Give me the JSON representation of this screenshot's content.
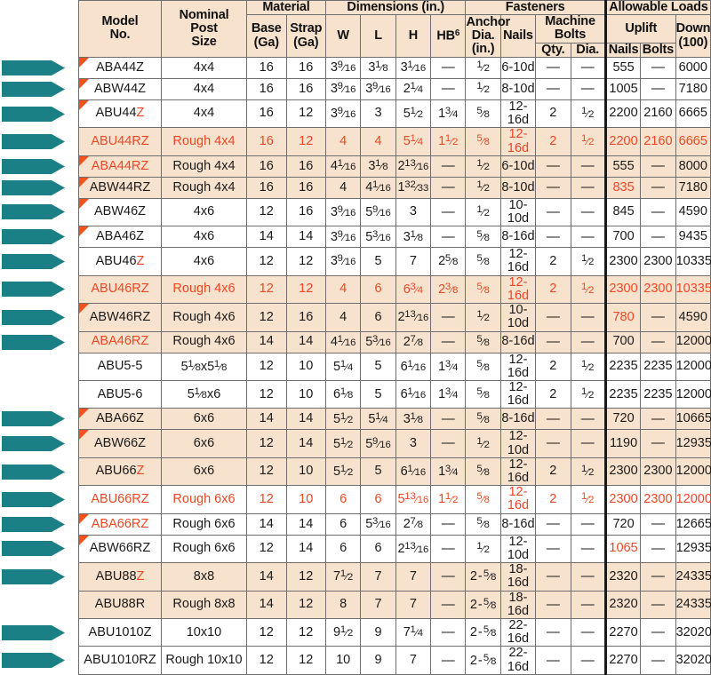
{
  "header": {
    "model_no": "Model\nNo.",
    "model_no_l1": "Model",
    "model_no_l2": "No.",
    "nominal_l1": "Nominal",
    "nominal_l2": "Post",
    "nominal_l3": "Size",
    "material": "Material",
    "base_ga_l1": "Base",
    "base_ga_l2": "(Ga)",
    "strap_ga_l1": "Strap",
    "strap_ga_l2": "(Ga)",
    "dimensions": "Dimensions (in.)",
    "w": "W",
    "l": "L",
    "h": "H",
    "hb": "HB",
    "hb_note": "6",
    "fasteners": "Fasteners",
    "anchor_l1": "Anchor",
    "anchor_l2": "Dia.",
    "anchor_l3": "(in.)",
    "nails": "Nails",
    "machine_l1": "Machine",
    "machine_l2": "Bolts",
    "qty": "Qty.",
    "dia": "Dia.",
    "allowable_loads": "Allowable Loads",
    "uplift": "Uplift",
    "uplift_nails": "Nails",
    "uplift_bolts": "Bolts",
    "down_l1": "Down",
    "down_l2": "(100)"
  },
  "colors": {
    "accent_red": "#ef4623",
    "shade_beige": "#f7e2ce",
    "teal_arrow": "#1a8086",
    "corner_orange": "#f4511e",
    "border": "#6e6e6e"
  },
  "rows": [
    {
      "model": "ABA44Z",
      "model_red_suffix": "",
      "post": "4x4",
      "base": "16",
      "strap": "16",
      "w": "3 9/16",
      "l": "3 1/8",
      "h": "3 1/16",
      "hb": "—",
      "anchor": "1/2",
      "nails": "6-10d",
      "qty": "—",
      "dia": "—",
      "up_nails": "555",
      "up_bolts": "—",
      "down": "6000",
      "shade": false,
      "arrow": true,
      "corner": true,
      "red_row": false,
      "red_cells": []
    },
    {
      "model": "ABW44Z",
      "model_red_suffix": "",
      "post": "4x4",
      "base": "16",
      "strap": "16",
      "w": "3 9/16",
      "l": "3 9/16",
      "h": "2 1/4",
      "hb": "—",
      "anchor": "1/2",
      "nails": "8-10d",
      "qty": "—",
      "dia": "—",
      "up_nails": "1005",
      "up_bolts": "—",
      "down": "7180",
      "shade": false,
      "arrow": true,
      "corner": true,
      "red_row": false,
      "red_cells": []
    },
    {
      "model": "ABU44",
      "model_red_suffix": "Z",
      "post": "4x4",
      "base": "16",
      "strap": "12",
      "w": "3 9/16",
      "l": "3",
      "h": "5 1/2",
      "hb": "1 3/4",
      "anchor": "5/8",
      "nails": "12-16d",
      "qty": "2",
      "dia": "1/2",
      "up_nails": "2200",
      "up_bolts": "2160",
      "down": "6665",
      "shade": false,
      "arrow": true,
      "corner": true,
      "red_row": false,
      "red_cells": []
    },
    {
      "model": "ABU44RZ",
      "model_red_suffix": "",
      "post": "Rough 4x4",
      "base": "16",
      "strap": "12",
      "w": "4",
      "l": "4",
      "h": "5 1/4",
      "hb": "1 1/2",
      "anchor": "5/8",
      "nails": "12-16d",
      "qty": "2",
      "dia": "1/2",
      "up_nails": "2200",
      "up_bolts": "2160",
      "down": "6665",
      "shade": true,
      "arrow": true,
      "corner": false,
      "red_row": true,
      "red_cells": []
    },
    {
      "model": "ABA44RZ",
      "model_red_suffix": "",
      "post": "Rough 4x4",
      "base": "16",
      "strap": "16",
      "w": "4 1/16",
      "l": "3 1/8",
      "h": "2 13/16",
      "hb": "—",
      "anchor": "1/2",
      "nails": "6-10d",
      "qty": "—",
      "dia": "—",
      "up_nails": "555",
      "up_bolts": "—",
      "down": "8000",
      "shade": true,
      "arrow": true,
      "corner": true,
      "red_row": false,
      "red_cells": [
        "model"
      ]
    },
    {
      "model": "ABW44RZ",
      "model_red_suffix": "",
      "post": "Rough 4x4",
      "base": "16",
      "strap": "16",
      "w": "4",
      "l": "4 1/16",
      "h": "1 32/33",
      "hb": "—",
      "anchor": "1/2",
      "nails": "8-10d",
      "qty": "—",
      "dia": "—",
      "up_nails": "835",
      "up_bolts": "—",
      "down": "7180",
      "shade": true,
      "arrow": true,
      "corner": true,
      "red_row": false,
      "red_cells": [
        "up_nails"
      ]
    },
    {
      "model": "ABW46Z",
      "model_red_suffix": "",
      "post": "4x6",
      "base": "12",
      "strap": "16",
      "w": "3 9/16",
      "l": "5 9/16",
      "h": "3",
      "hb": "—",
      "anchor": "1/2",
      "nails": "10-10d",
      "qty": "—",
      "dia": "—",
      "up_nails": "845",
      "up_bolts": "—",
      "down": "4590",
      "shade": false,
      "arrow": true,
      "corner": true,
      "red_row": false,
      "red_cells": []
    },
    {
      "model": "ABA46Z",
      "model_red_suffix": "",
      "post": "4x6",
      "base": "14",
      "strap": "14",
      "w": "3 9/16",
      "l": "5 3/16",
      "h": "3 1/8",
      "hb": "—",
      "anchor": "5/8",
      "nails": "8-16d",
      "qty": "—",
      "dia": "—",
      "up_nails": "700",
      "up_bolts": "—",
      "down": "9435",
      "shade": false,
      "arrow": true,
      "corner": true,
      "red_row": false,
      "red_cells": []
    },
    {
      "model": "ABU46",
      "model_red_suffix": "Z",
      "post": "4x6",
      "base": "12",
      "strap": "12",
      "w": "3 9/16",
      "l": "5",
      "h": "7",
      "hb": "2 5/8",
      "anchor": "5/8",
      "nails": "12-16d",
      "qty": "2",
      "dia": "1/2",
      "up_nails": "2300",
      "up_bolts": "2300",
      "down": "10335",
      "shade": false,
      "arrow": true,
      "corner": false,
      "red_row": false,
      "red_cells": []
    },
    {
      "model": "ABU46RZ",
      "model_red_suffix": "",
      "post": "Rough 4x6",
      "base": "12",
      "strap": "12",
      "w": "4",
      "l": "6",
      "h": "6 3/4",
      "hb": "2 3/8",
      "anchor": "5/8",
      "nails": "12-16d",
      "qty": "2",
      "dia": "1/2",
      "up_nails": "2300",
      "up_bolts": "2300",
      "down": "10335",
      "shade": true,
      "arrow": true,
      "corner": false,
      "red_row": true,
      "red_cells": []
    },
    {
      "model": "ABW46RZ",
      "model_red_suffix": "",
      "post": "Rough 4x6",
      "base": "12",
      "strap": "16",
      "w": "4",
      "l": "6",
      "h": "2 13/16",
      "hb": "—",
      "anchor": "1/2",
      "nails": "10-10d",
      "qty": "—",
      "dia": "—",
      "up_nails": "780",
      "up_bolts": "—",
      "down": "4590",
      "shade": true,
      "arrow": true,
      "corner": true,
      "red_row": false,
      "red_cells": [
        "up_nails"
      ]
    },
    {
      "model": "ABA46RZ",
      "model_red_suffix": "",
      "post": "Rough 4x6",
      "base": "14",
      "strap": "14",
      "w": "4 1/16",
      "l": "5 3/16",
      "h": "2 7/8",
      "hb": "—",
      "anchor": "5/8",
      "nails": "8-16d",
      "qty": "—",
      "dia": "—",
      "up_nails": "700",
      "up_bolts": "—",
      "down": "12000",
      "shade": true,
      "arrow": true,
      "corner": false,
      "red_row": false,
      "red_cells": [
        "model"
      ]
    },
    {
      "model": "ABU5-5",
      "model_red_suffix": "",
      "post": "5 1/8x5 1/8",
      "base": "12",
      "strap": "10",
      "w": "5 1/4",
      "l": "5",
      "h": "6 1/16",
      "hb": "1 3/4",
      "anchor": "5/8",
      "nails": "12-16d",
      "qty": "2",
      "dia": "1/2",
      "up_nails": "2235",
      "up_bolts": "2235",
      "down": "12000",
      "shade": false,
      "arrow": false,
      "corner": false,
      "red_row": false,
      "red_cells": []
    },
    {
      "model": "ABU5-6",
      "model_red_suffix": "",
      "post": "5 1/8x6",
      "base": "12",
      "strap": "10",
      "w": "6 1/8",
      "l": "5",
      "h": "6 1/16",
      "hb": "1 3/4",
      "anchor": "5/8",
      "nails": "12-16d",
      "qty": "2",
      "dia": "1/2",
      "up_nails": "2235",
      "up_bolts": "2235",
      "down": "12000",
      "shade": false,
      "arrow": false,
      "corner": false,
      "red_row": false,
      "red_cells": []
    },
    {
      "model": "ABA66Z",
      "model_red_suffix": "",
      "post": "6x6",
      "base": "14",
      "strap": "14",
      "w": "5 1/2",
      "l": "5 1/4",
      "h": "3 1/8",
      "hb": "—",
      "anchor": "5/8",
      "nails": "8-16d",
      "qty": "—",
      "dia": "—",
      "up_nails": "720",
      "up_bolts": "—",
      "down": "10665",
      "shade": true,
      "arrow": true,
      "corner": true,
      "red_row": false,
      "red_cells": []
    },
    {
      "model": "ABW66Z",
      "model_red_suffix": "",
      "post": "6x6",
      "base": "12",
      "strap": "14",
      "w": "5 1/2",
      "l": "5 9/16",
      "h": "3",
      "hb": "—",
      "anchor": "1/2",
      "nails": "12-10d",
      "qty": "—",
      "dia": "—",
      "up_nails": "1190",
      "up_bolts": "—",
      "down": "12935",
      "shade": true,
      "arrow": true,
      "corner": true,
      "red_row": false,
      "red_cells": []
    },
    {
      "model": "ABU66",
      "model_red_suffix": "Z",
      "post": "6x6",
      "base": "12",
      "strap": "10",
      "w": "5 1/2",
      "l": "5",
      "h": "6 1/16",
      "hb": "1 3/4",
      "anchor": "5/8",
      "nails": "12-16d",
      "qty": "2",
      "dia": "1/2",
      "up_nails": "2300",
      "up_bolts": "2300",
      "down": "12000",
      "shade": true,
      "arrow": true,
      "corner": false,
      "red_row": false,
      "red_cells": []
    },
    {
      "model": "ABU66RZ",
      "model_red_suffix": "",
      "post": "Rough 6x6",
      "base": "12",
      "strap": "10",
      "w": "6",
      "l": "6",
      "h": "5 13/16",
      "hb": "1 1/2",
      "anchor": "5/8",
      "nails": "12-16d",
      "qty": "2",
      "dia": "1/2",
      "up_nails": "2300",
      "up_bolts": "2300",
      "down": "12000",
      "shade": false,
      "arrow": true,
      "corner": false,
      "red_row": true,
      "red_cells": []
    },
    {
      "model": "ABA66RZ",
      "model_red_suffix": "",
      "post": "Rough 6x6",
      "base": "14",
      "strap": "14",
      "w": "6",
      "l": "5 3/16",
      "h": "2 7/8",
      "hb": "—",
      "anchor": "5/8",
      "nails": "8-16d",
      "qty": "—",
      "dia": "—",
      "up_nails": "720",
      "up_bolts": "—",
      "down": "12665",
      "shade": false,
      "arrow": true,
      "corner": true,
      "red_row": false,
      "red_cells": [
        "model"
      ]
    },
    {
      "model": "ABW66RZ",
      "model_red_suffix": "",
      "post": "Rough 6x6",
      "base": "12",
      "strap": "14",
      "w": "6",
      "l": "6",
      "h": "2 13/16",
      "hb": "—",
      "anchor": "1/2",
      "nails": "12-10d",
      "qty": "—",
      "dia": "—",
      "up_nails": "1065",
      "up_bolts": "—",
      "down": "12935",
      "shade": false,
      "arrow": true,
      "corner": true,
      "red_row": false,
      "red_cells": [
        "up_nails"
      ]
    },
    {
      "model": "ABU88",
      "model_red_suffix": "Z",
      "post": "8x8",
      "base": "14",
      "strap": "12",
      "w": "7 1/2",
      "l": "7",
      "h": "7",
      "hb": "—",
      "anchor": "2 - 5/8",
      "nails": "18-16d",
      "qty": "—",
      "dia": "—",
      "up_nails": "2320",
      "up_bolts": "—",
      "down": "24335",
      "shade": true,
      "arrow": true,
      "corner": false,
      "red_row": false,
      "red_cells": []
    },
    {
      "model": "ABU88R",
      "model_red_suffix": "",
      "post": "Rough 8x8",
      "base": "14",
      "strap": "12",
      "w": "8",
      "l": "7",
      "h": "7",
      "hb": "—",
      "anchor": "2 - 5/8",
      "nails": "18-16d",
      "qty": "—",
      "dia": "—",
      "up_nails": "2320",
      "up_bolts": "—",
      "down": "24335",
      "shade": true,
      "arrow": false,
      "corner": false,
      "red_row": false,
      "red_cells": []
    },
    {
      "model": "ABU1010Z",
      "model_red_suffix": "",
      "post": "10x10",
      "base": "12",
      "strap": "12",
      "w": "9 1/2",
      "l": "9",
      "h": "7 1/4",
      "hb": "—",
      "anchor": "2 - 5/8",
      "nails": "22-16d",
      "qty": "—",
      "dia": "—",
      "up_nails": "2270",
      "up_bolts": "—",
      "down": "32020",
      "shade": false,
      "arrow": true,
      "corner": false,
      "red_row": false,
      "red_cells": []
    },
    {
      "model": "ABU1010RZ",
      "model_red_suffix": "",
      "post": "Rough 10x10",
      "base": "12",
      "strap": "12",
      "w": "10",
      "l": "9",
      "h": "7",
      "hb": "—",
      "anchor": "2 - 5/8",
      "nails": "22-16d",
      "qty": "—",
      "dia": "—",
      "up_nails": "2270",
      "up_bolts": "—",
      "down": "32020",
      "shade": false,
      "arrow": true,
      "corner": false,
      "red_row": false,
      "red_cells": []
    }
  ]
}
